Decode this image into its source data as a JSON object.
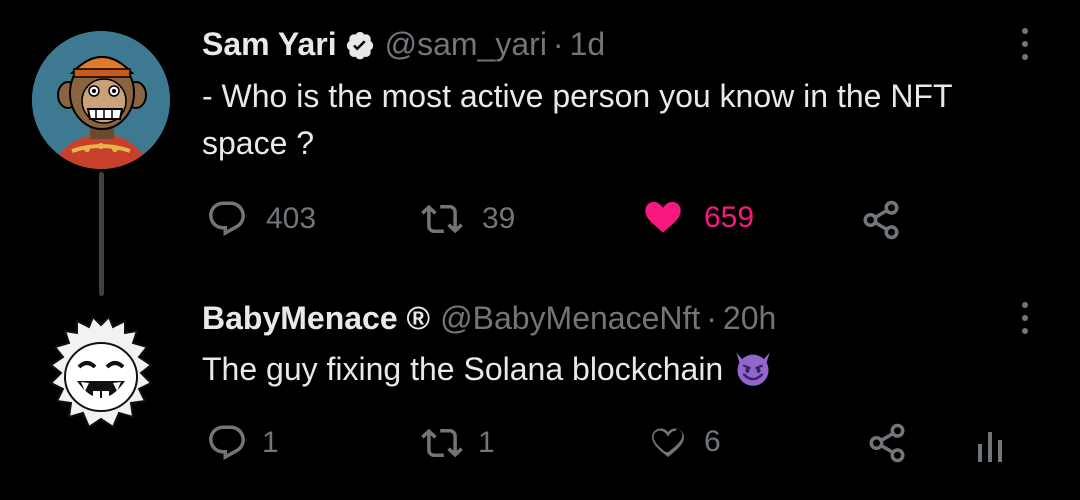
{
  "tweet1": {
    "name": "Sam Yari",
    "handle": "@sam_yari",
    "separator": "·",
    "time": "1d",
    "text": "- Who is the most active person you know in the NFT space ?",
    "replies": "403",
    "retweets": "39",
    "likes": "659",
    "liked": true,
    "icons": [
      "verified-badge-icon",
      "reply-icon",
      "retweet-icon",
      "heart-filled-icon",
      "share-icon",
      "more-icon"
    ]
  },
  "tweet2": {
    "name": "BabyMenace ®",
    "handle": "@BabyMenaceNft",
    "separator": "·",
    "time": "20h",
    "text": "The guy fixing the Solana blockchain",
    "emoji": "smiling-devil-emoji",
    "replies": "1",
    "retweets": "1",
    "likes": "6",
    "liked": false,
    "icons": [
      "reply-icon",
      "retweet-icon",
      "heart-outline-icon",
      "share-icon",
      "analytics-icon",
      "more-icon"
    ]
  },
  "colors": {
    "background": "#000000",
    "text_primary": "#e7e9ea",
    "text_secondary": "#71767b",
    "like_pink": "#f91880",
    "thread_line": "#3e4144"
  }
}
